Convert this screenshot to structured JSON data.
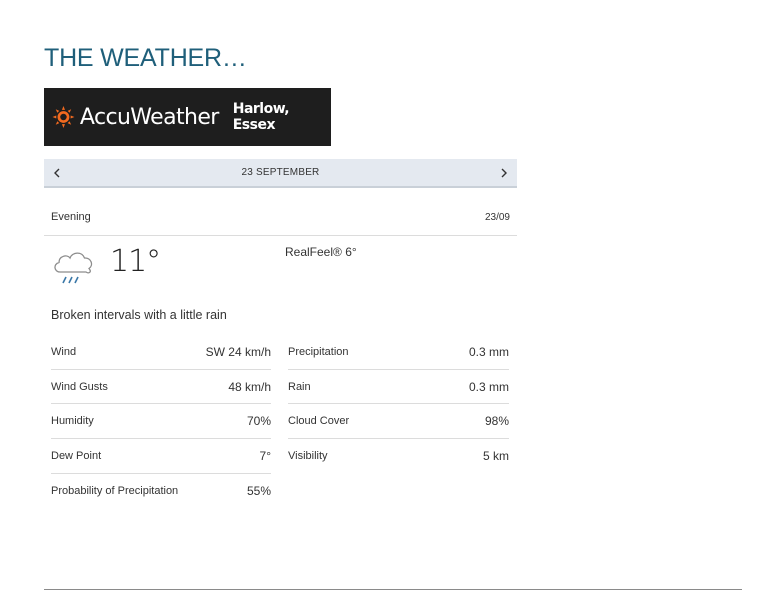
{
  "page": {
    "title": "THE WEATHER…"
  },
  "brand": {
    "name": "AccuWeather",
    "location": "Harlow, Essex",
    "accent": "#f26a1f"
  },
  "nav": {
    "date": "23 SEPTEMBER",
    "prev_icon": "chevron-left-icon",
    "next_icon": "chevron-right-icon"
  },
  "period": {
    "label": "Evening",
    "date": "23/09"
  },
  "current": {
    "icon": "cloud-rain-icon",
    "temperature": "11°",
    "realfeel": "RealFeel® 6°",
    "phrase": "Broken intervals with a little rain"
  },
  "details": {
    "left": [
      {
        "name": "Wind",
        "value": "SW 24 km/h"
      },
      {
        "name": "Wind Gusts",
        "value": "48 km/h"
      },
      {
        "name": "Humidity",
        "value": "70%"
      },
      {
        "name": "Dew Point",
        "value": "7°"
      },
      {
        "name": "Probability of Precipitation",
        "value": "55%"
      }
    ],
    "right": [
      {
        "name": "Precipitation",
        "value": "0.3 mm"
      },
      {
        "name": "Rain",
        "value": "0.3 mm"
      },
      {
        "name": "Cloud Cover",
        "value": "98%"
      },
      {
        "name": "Visibility",
        "value": "5 km"
      }
    ]
  }
}
